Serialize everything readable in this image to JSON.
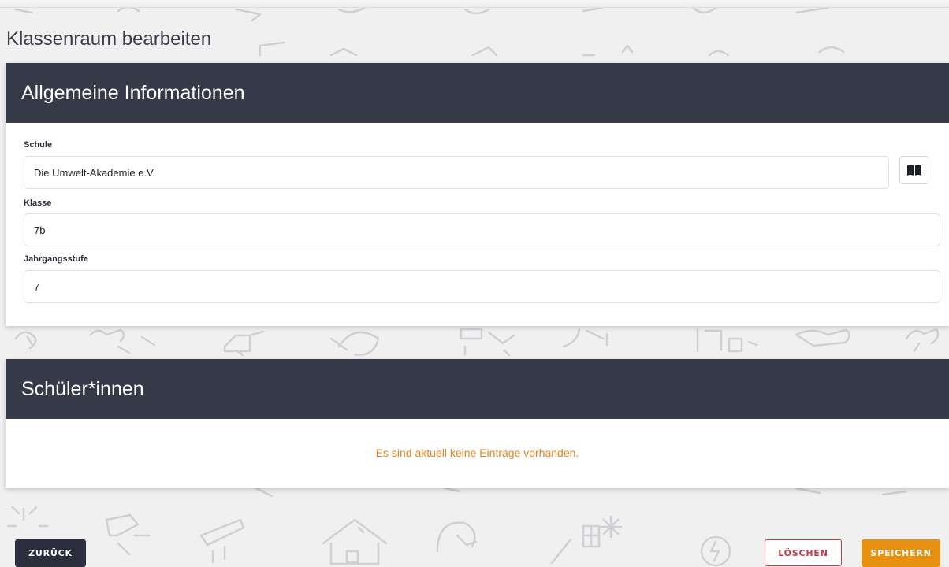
{
  "page": {
    "title": "Klassenraum bearbeiten"
  },
  "general_card": {
    "header": "Allgemeine Informationen",
    "fields": [
      {
        "label": "Schule",
        "value": "Die Umwelt-Akademie e.V."
      },
      {
        "label": "Klasse",
        "value": "7b"
      },
      {
        "label": "Jahrgangsstufe",
        "value": "7"
      }
    ],
    "lookup_icon": "book-icon"
  },
  "students_card": {
    "header": "Schüler*innen",
    "empty_message": "Es sind aktuell keine Einträge vorhanden."
  },
  "actions": {
    "back_label": "ZURÜCK",
    "delete_label": "LÖSCHEN",
    "save_label": "SPEICHERN"
  },
  "colors": {
    "header_bg": "#363a48",
    "accent_orange": "#e8900f",
    "danger_red": "#c53b44",
    "empty_text": "#e0851f"
  }
}
